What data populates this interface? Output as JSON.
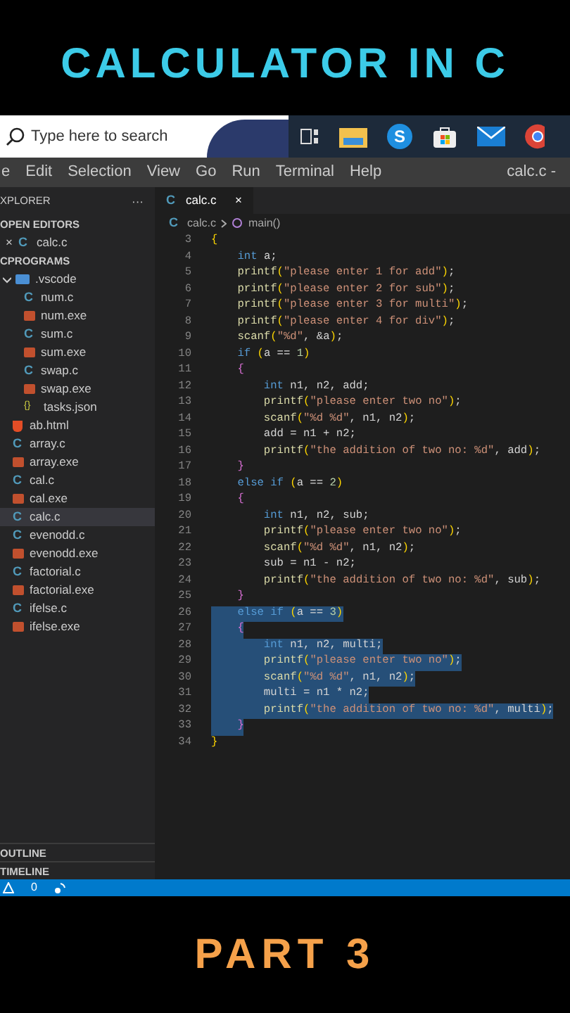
{
  "video_title": "CALCULATOR IN C",
  "taskbar": {
    "search_placeholder": "Type here to search",
    "chat_app_letter": "S"
  },
  "menu": {
    "items": [
      "e",
      "Edit",
      "Selection",
      "View",
      "Go",
      "Run",
      "Terminal",
      "Help"
    ],
    "window_title": "calc.c -"
  },
  "sidebar": {
    "header": "XPLORER",
    "more": "···",
    "open_editors": {
      "label": "OPEN EDITORS",
      "items": [
        {
          "label": "calc.c",
          "kind": "c",
          "icon": "C",
          "close": "×"
        }
      ]
    },
    "folder": {
      "label": "CPROGRAMS",
      "items": [
        {
          "label": ".vscode",
          "kind": "folder",
          "expanded": true,
          "selected": false,
          "children": [
            {
              "label": "num.c",
              "kind": "c",
              "icon": "C",
              "selected": false
            },
            {
              "label": "num.exe",
              "kind": "exe",
              "selected": false
            },
            {
              "label": "sum.c",
              "kind": "c",
              "icon": "C",
              "selected": false
            },
            {
              "label": "sum.exe",
              "kind": "exe",
              "selected": false
            },
            {
              "label": "swap.c",
              "kind": "c",
              "icon": "C",
              "selected": false
            },
            {
              "label": "swap.exe",
              "kind": "exe",
              "selected": false
            },
            {
              "label": "tasks.json",
              "kind": "json",
              "icon": "{}",
              "selected": false
            }
          ]
        },
        {
          "label": "ab.html",
          "kind": "html",
          "selected": false
        },
        {
          "label": "array.c",
          "kind": "c",
          "icon": "C",
          "selected": false
        },
        {
          "label": "array.exe",
          "kind": "exe",
          "selected": false
        },
        {
          "label": "cal.c",
          "kind": "c",
          "icon": "C",
          "selected": false
        },
        {
          "label": "cal.exe",
          "kind": "exe",
          "selected": false
        },
        {
          "label": "calc.c",
          "kind": "c",
          "icon": "C",
          "selected": true
        },
        {
          "label": "evenodd.c",
          "kind": "c",
          "icon": "C",
          "selected": false
        },
        {
          "label": "evenodd.exe",
          "kind": "exe",
          "selected": false
        },
        {
          "label": "factorial.c",
          "kind": "c",
          "icon": "C",
          "selected": false
        },
        {
          "label": "factorial.exe",
          "kind": "exe",
          "selected": false
        },
        {
          "label": "ifelse.c",
          "kind": "c",
          "icon": "C",
          "selected": false
        },
        {
          "label": "ifelse.exe",
          "kind": "exe",
          "selected": false
        }
      ]
    },
    "panels": [
      "OUTLINE",
      "TIMELINE"
    ]
  },
  "editor": {
    "tabs": [
      {
        "label": "calc.c",
        "icon": "C",
        "close": "×",
        "selected": true
      }
    ],
    "breadcrumb": [
      {
        "label": "calc.c",
        "kind": "c",
        "icon": "C"
      },
      {
        "label": "main()",
        "kind": "function"
      }
    ],
    "lines": [
      {
        "n": "3",
        "selected": false,
        "tokens": [
          {
            "text": "{",
            "kind": "br"
          }
        ]
      },
      {
        "n": "4",
        "selected": false,
        "tokens": [
          {
            "text": "    int",
            "kind": "kw"
          },
          {
            "text": " a;",
            "kind": "p"
          }
        ]
      },
      {
        "n": "5",
        "selected": false,
        "tokens": [
          {
            "text": "    printf",
            "kind": "fn"
          },
          {
            "text": "(",
            "kind": "br"
          },
          {
            "text": "\"please enter 1 for add\"",
            "kind": "str"
          },
          {
            "text": ")",
            "kind": "br"
          },
          {
            "text": ";",
            "kind": "p"
          }
        ]
      },
      {
        "n": "6",
        "selected": false,
        "tokens": [
          {
            "text": "    printf",
            "kind": "fn"
          },
          {
            "text": "(",
            "kind": "br"
          },
          {
            "text": "\"please enter 2 for sub\"",
            "kind": "str"
          },
          {
            "text": ")",
            "kind": "br"
          },
          {
            "text": ";",
            "kind": "p"
          }
        ]
      },
      {
        "n": "7",
        "selected": false,
        "tokens": [
          {
            "text": "    printf",
            "kind": "fn"
          },
          {
            "text": "(",
            "kind": "br"
          },
          {
            "text": "\"please enter 3 for multi\"",
            "kind": "str"
          },
          {
            "text": ")",
            "kind": "br"
          },
          {
            "text": ";",
            "kind": "p"
          }
        ]
      },
      {
        "n": "8",
        "selected": false,
        "tokens": [
          {
            "text": "    printf",
            "kind": "fn"
          },
          {
            "text": "(",
            "kind": "br"
          },
          {
            "text": "\"please enter 4 for div\"",
            "kind": "str"
          },
          {
            "text": ")",
            "kind": "br"
          },
          {
            "text": ";",
            "kind": "p"
          }
        ]
      },
      {
        "n": "9",
        "selected": false,
        "tokens": [
          {
            "text": "    scanf",
            "kind": "fn"
          },
          {
            "text": "(",
            "kind": "br"
          },
          {
            "text": "\"%d\"",
            "kind": "str"
          },
          {
            "text": ", &a",
            "kind": "p"
          },
          {
            "text": ")",
            "kind": "br"
          },
          {
            "text": ";",
            "kind": "p"
          }
        ]
      },
      {
        "n": "10",
        "selected": false,
        "tokens": [
          {
            "text": "    if",
            "kind": "kw"
          },
          {
            "text": " (",
            "kind": "br"
          },
          {
            "text": "a == ",
            "kind": "p"
          },
          {
            "text": "1",
            "kind": "num"
          },
          {
            "text": ")",
            "kind": "br"
          }
        ]
      },
      {
        "n": "11",
        "selected": false,
        "tokens": [
          {
            "text": "    {",
            "kind": "br2"
          }
        ]
      },
      {
        "n": "12",
        "selected": false,
        "tokens": [
          {
            "text": "        int",
            "kind": "kw"
          },
          {
            "text": " n1, n2, add;",
            "kind": "p"
          }
        ]
      },
      {
        "n": "13",
        "selected": false,
        "tokens": [
          {
            "text": "        printf",
            "kind": "fn"
          },
          {
            "text": "(",
            "kind": "br"
          },
          {
            "text": "\"please enter two no\"",
            "kind": "str"
          },
          {
            "text": ")",
            "kind": "br"
          },
          {
            "text": ";",
            "kind": "p"
          }
        ]
      },
      {
        "n": "14",
        "selected": false,
        "tokens": [
          {
            "text": "        scanf",
            "kind": "fn"
          },
          {
            "text": "(",
            "kind": "br"
          },
          {
            "text": "\"%d %d\"",
            "kind": "str"
          },
          {
            "text": ", n1, n2",
            "kind": "p"
          },
          {
            "text": ")",
            "kind": "br"
          },
          {
            "text": ";",
            "kind": "p"
          }
        ]
      },
      {
        "n": "15",
        "selected": false,
        "tokens": [
          {
            "text": "        add = n1 + n2;",
            "kind": "p"
          }
        ]
      },
      {
        "n": "16",
        "selected": false,
        "tokens": [
          {
            "text": "        printf",
            "kind": "fn"
          },
          {
            "text": "(",
            "kind": "br"
          },
          {
            "text": "\"the addition of two no: %d\"",
            "kind": "str"
          },
          {
            "text": ", add",
            "kind": "p"
          },
          {
            "text": ")",
            "kind": "br"
          },
          {
            "text": ";",
            "kind": "p"
          }
        ]
      },
      {
        "n": "17",
        "selected": false,
        "tokens": [
          {
            "text": "    }",
            "kind": "br2"
          }
        ]
      },
      {
        "n": "18",
        "selected": false,
        "tokens": [
          {
            "text": "    else if",
            "kind": "kw"
          },
          {
            "text": " (",
            "kind": "br"
          },
          {
            "text": "a == ",
            "kind": "p"
          },
          {
            "text": "2",
            "kind": "num"
          },
          {
            "text": ")",
            "kind": "br"
          }
        ]
      },
      {
        "n": "19",
        "selected": false,
        "tokens": [
          {
            "text": "    {",
            "kind": "br2"
          }
        ]
      },
      {
        "n": "20",
        "selected": false,
        "tokens": [
          {
            "text": "        int",
            "kind": "kw"
          },
          {
            "text": " n1, n2, sub;",
            "kind": "p"
          }
        ]
      },
      {
        "n": "21",
        "selected": false,
        "tokens": [
          {
            "text": "        printf",
            "kind": "fn"
          },
          {
            "text": "(",
            "kind": "br"
          },
          {
            "text": "\"please enter two no\"",
            "kind": "str"
          },
          {
            "text": ")",
            "kind": "br"
          },
          {
            "text": ";",
            "kind": "p"
          }
        ]
      },
      {
        "n": "22",
        "selected": false,
        "tokens": [
          {
            "text": "        scanf",
            "kind": "fn"
          },
          {
            "text": "(",
            "kind": "br"
          },
          {
            "text": "\"%d %d\"",
            "kind": "str"
          },
          {
            "text": ", n1, n2",
            "kind": "p"
          },
          {
            "text": ")",
            "kind": "br"
          },
          {
            "text": ";",
            "kind": "p"
          }
        ]
      },
      {
        "n": "23",
        "selected": false,
        "tokens": [
          {
            "text": "        sub = n1 - n2;",
            "kind": "p"
          }
        ]
      },
      {
        "n": "24",
        "selected": false,
        "tokens": [
          {
            "text": "        printf",
            "kind": "fn"
          },
          {
            "text": "(",
            "kind": "br"
          },
          {
            "text": "\"the addition of two no: %d\"",
            "kind": "str"
          },
          {
            "text": ", sub",
            "kind": "p"
          },
          {
            "text": ")",
            "kind": "br"
          },
          {
            "text": ";",
            "kind": "p"
          }
        ]
      },
      {
        "n": "25",
        "selected": false,
        "tokens": [
          {
            "text": "    }",
            "kind": "br2"
          }
        ]
      },
      {
        "n": "26",
        "selected": true,
        "tokens": [
          {
            "text": "    else if",
            "kind": "kw"
          },
          {
            "text": " (",
            "kind": "br"
          },
          {
            "text": "a == ",
            "kind": "p"
          },
          {
            "text": "3",
            "kind": "num"
          },
          {
            "text": ")",
            "kind": "br"
          }
        ]
      },
      {
        "n": "27",
        "selected": true,
        "tokens": [
          {
            "text": "    {",
            "kind": "br2"
          }
        ]
      },
      {
        "n": "28",
        "selected": true,
        "tokens": [
          {
            "text": "        int",
            "kind": "kw"
          },
          {
            "text": " n1, n2, multi;",
            "kind": "p"
          }
        ]
      },
      {
        "n": "29",
        "selected": true,
        "tokens": [
          {
            "text": "        printf",
            "kind": "fn"
          },
          {
            "text": "(",
            "kind": "br"
          },
          {
            "text": "\"please enter two no\"",
            "kind": "str"
          },
          {
            "text": ")",
            "kind": "br"
          },
          {
            "text": ";",
            "kind": "p"
          }
        ]
      },
      {
        "n": "30",
        "selected": true,
        "tokens": [
          {
            "text": "        scanf",
            "kind": "fn"
          },
          {
            "text": "(",
            "kind": "br"
          },
          {
            "text": "\"%d %d\"",
            "kind": "str"
          },
          {
            "text": ", n1, n2",
            "kind": "p"
          },
          {
            "text": ")",
            "kind": "br"
          },
          {
            "text": ";",
            "kind": "p"
          }
        ]
      },
      {
        "n": "31",
        "selected": true,
        "tokens": [
          {
            "text": "        multi = n1 * n2;",
            "kind": "p"
          }
        ]
      },
      {
        "n": "32",
        "selected": true,
        "tokens": [
          {
            "text": "        printf",
            "kind": "fn"
          },
          {
            "text": "(",
            "kind": "br"
          },
          {
            "text": "\"the addition of two no: %d\"",
            "kind": "str"
          },
          {
            "text": ", multi",
            "kind": "p"
          },
          {
            "text": ")",
            "kind": "br"
          },
          {
            "text": ";",
            "kind": "p"
          }
        ]
      },
      {
        "n": "33",
        "selected": true,
        "tokens": [
          {
            "text": "    }",
            "kind": "br2"
          }
        ]
      },
      {
        "n": "34",
        "selected": false,
        "tokens": [
          {
            "text": "}",
            "kind": "br"
          }
        ]
      }
    ]
  },
  "status_bar": {
    "warnings": "0"
  },
  "video_subtitle": "PART 3"
}
